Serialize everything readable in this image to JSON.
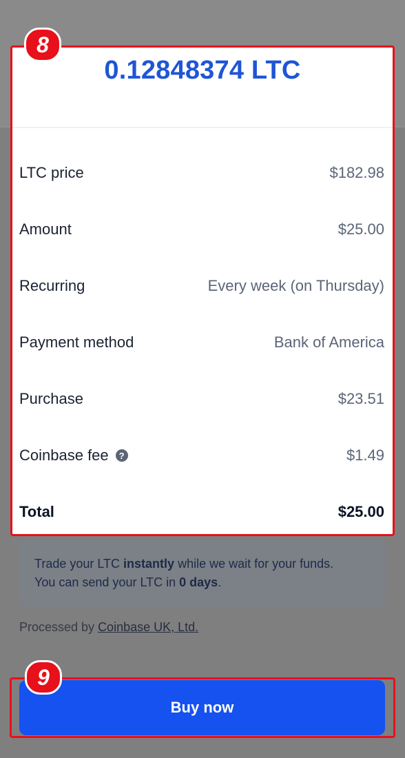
{
  "background_colors": {
    "overlay": "#7f7f7f",
    "accent": "#1652f0",
    "highlight": "#e8101a"
  },
  "card": {
    "amount": "0.12848374 LTC",
    "rows": [
      {
        "label": "LTC price",
        "value": "$182.98"
      },
      {
        "label": "Amount",
        "value": "$25.00"
      },
      {
        "label": "Recurring",
        "value": "Every week (on Thursday)"
      },
      {
        "label": "Payment method",
        "value": "Bank of America"
      },
      {
        "label": "Purchase",
        "value": "$23.51"
      },
      {
        "label": "Coinbase fee",
        "value": "$1.49",
        "icon": "help-icon"
      },
      {
        "label": "Total",
        "value": "$25.00"
      }
    ]
  },
  "info": {
    "line1_a": "Trade your LTC ",
    "line1_b": "instantly",
    "line1_c": " while we wait for your funds.",
    "line2_a": "You can send your LTC in ",
    "line2_b": "0 days",
    "line2_c": "."
  },
  "processed": {
    "prefix": "Processed by ",
    "link": "Coinbase UK, Ltd."
  },
  "button": {
    "label": "Buy now"
  },
  "badges": {
    "step_a": "8",
    "step_b": "9"
  }
}
